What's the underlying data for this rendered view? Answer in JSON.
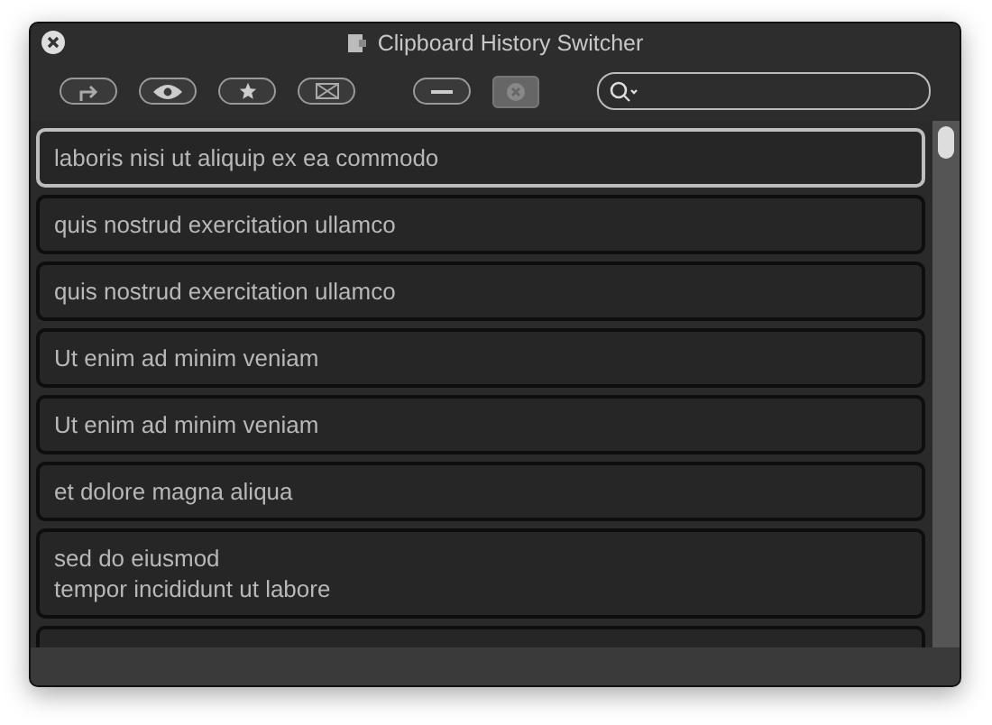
{
  "window": {
    "title": "Clipboard History Switcher"
  },
  "toolbar": {
    "buttons": [
      {
        "kind": "paste",
        "disabled": false
      },
      {
        "kind": "preview",
        "disabled": false
      },
      {
        "kind": "favorite",
        "disabled": false
      },
      {
        "kind": "mail",
        "disabled": false
      },
      {
        "kind": "remove",
        "disabled": false
      },
      {
        "kind": "clear",
        "disabled": true
      }
    ]
  },
  "items": [
    {
      "text": "laboris nisi ut aliquip ex ea commodo",
      "selected": true
    },
    {
      "text": "quis nostrud exercitation ullamco",
      "selected": false
    },
    {
      "text": "quis nostrud exercitation ullamco",
      "selected": false
    },
    {
      "text": "Ut enim ad minim veniam",
      "selected": false
    },
    {
      "text": "Ut enim ad minim veniam",
      "selected": false
    },
    {
      "text": "et dolore magna aliqua",
      "selected": false
    },
    {
      "text": "sed do eiusmod\ntempor incididunt ut labore",
      "selected": false
    }
  ]
}
